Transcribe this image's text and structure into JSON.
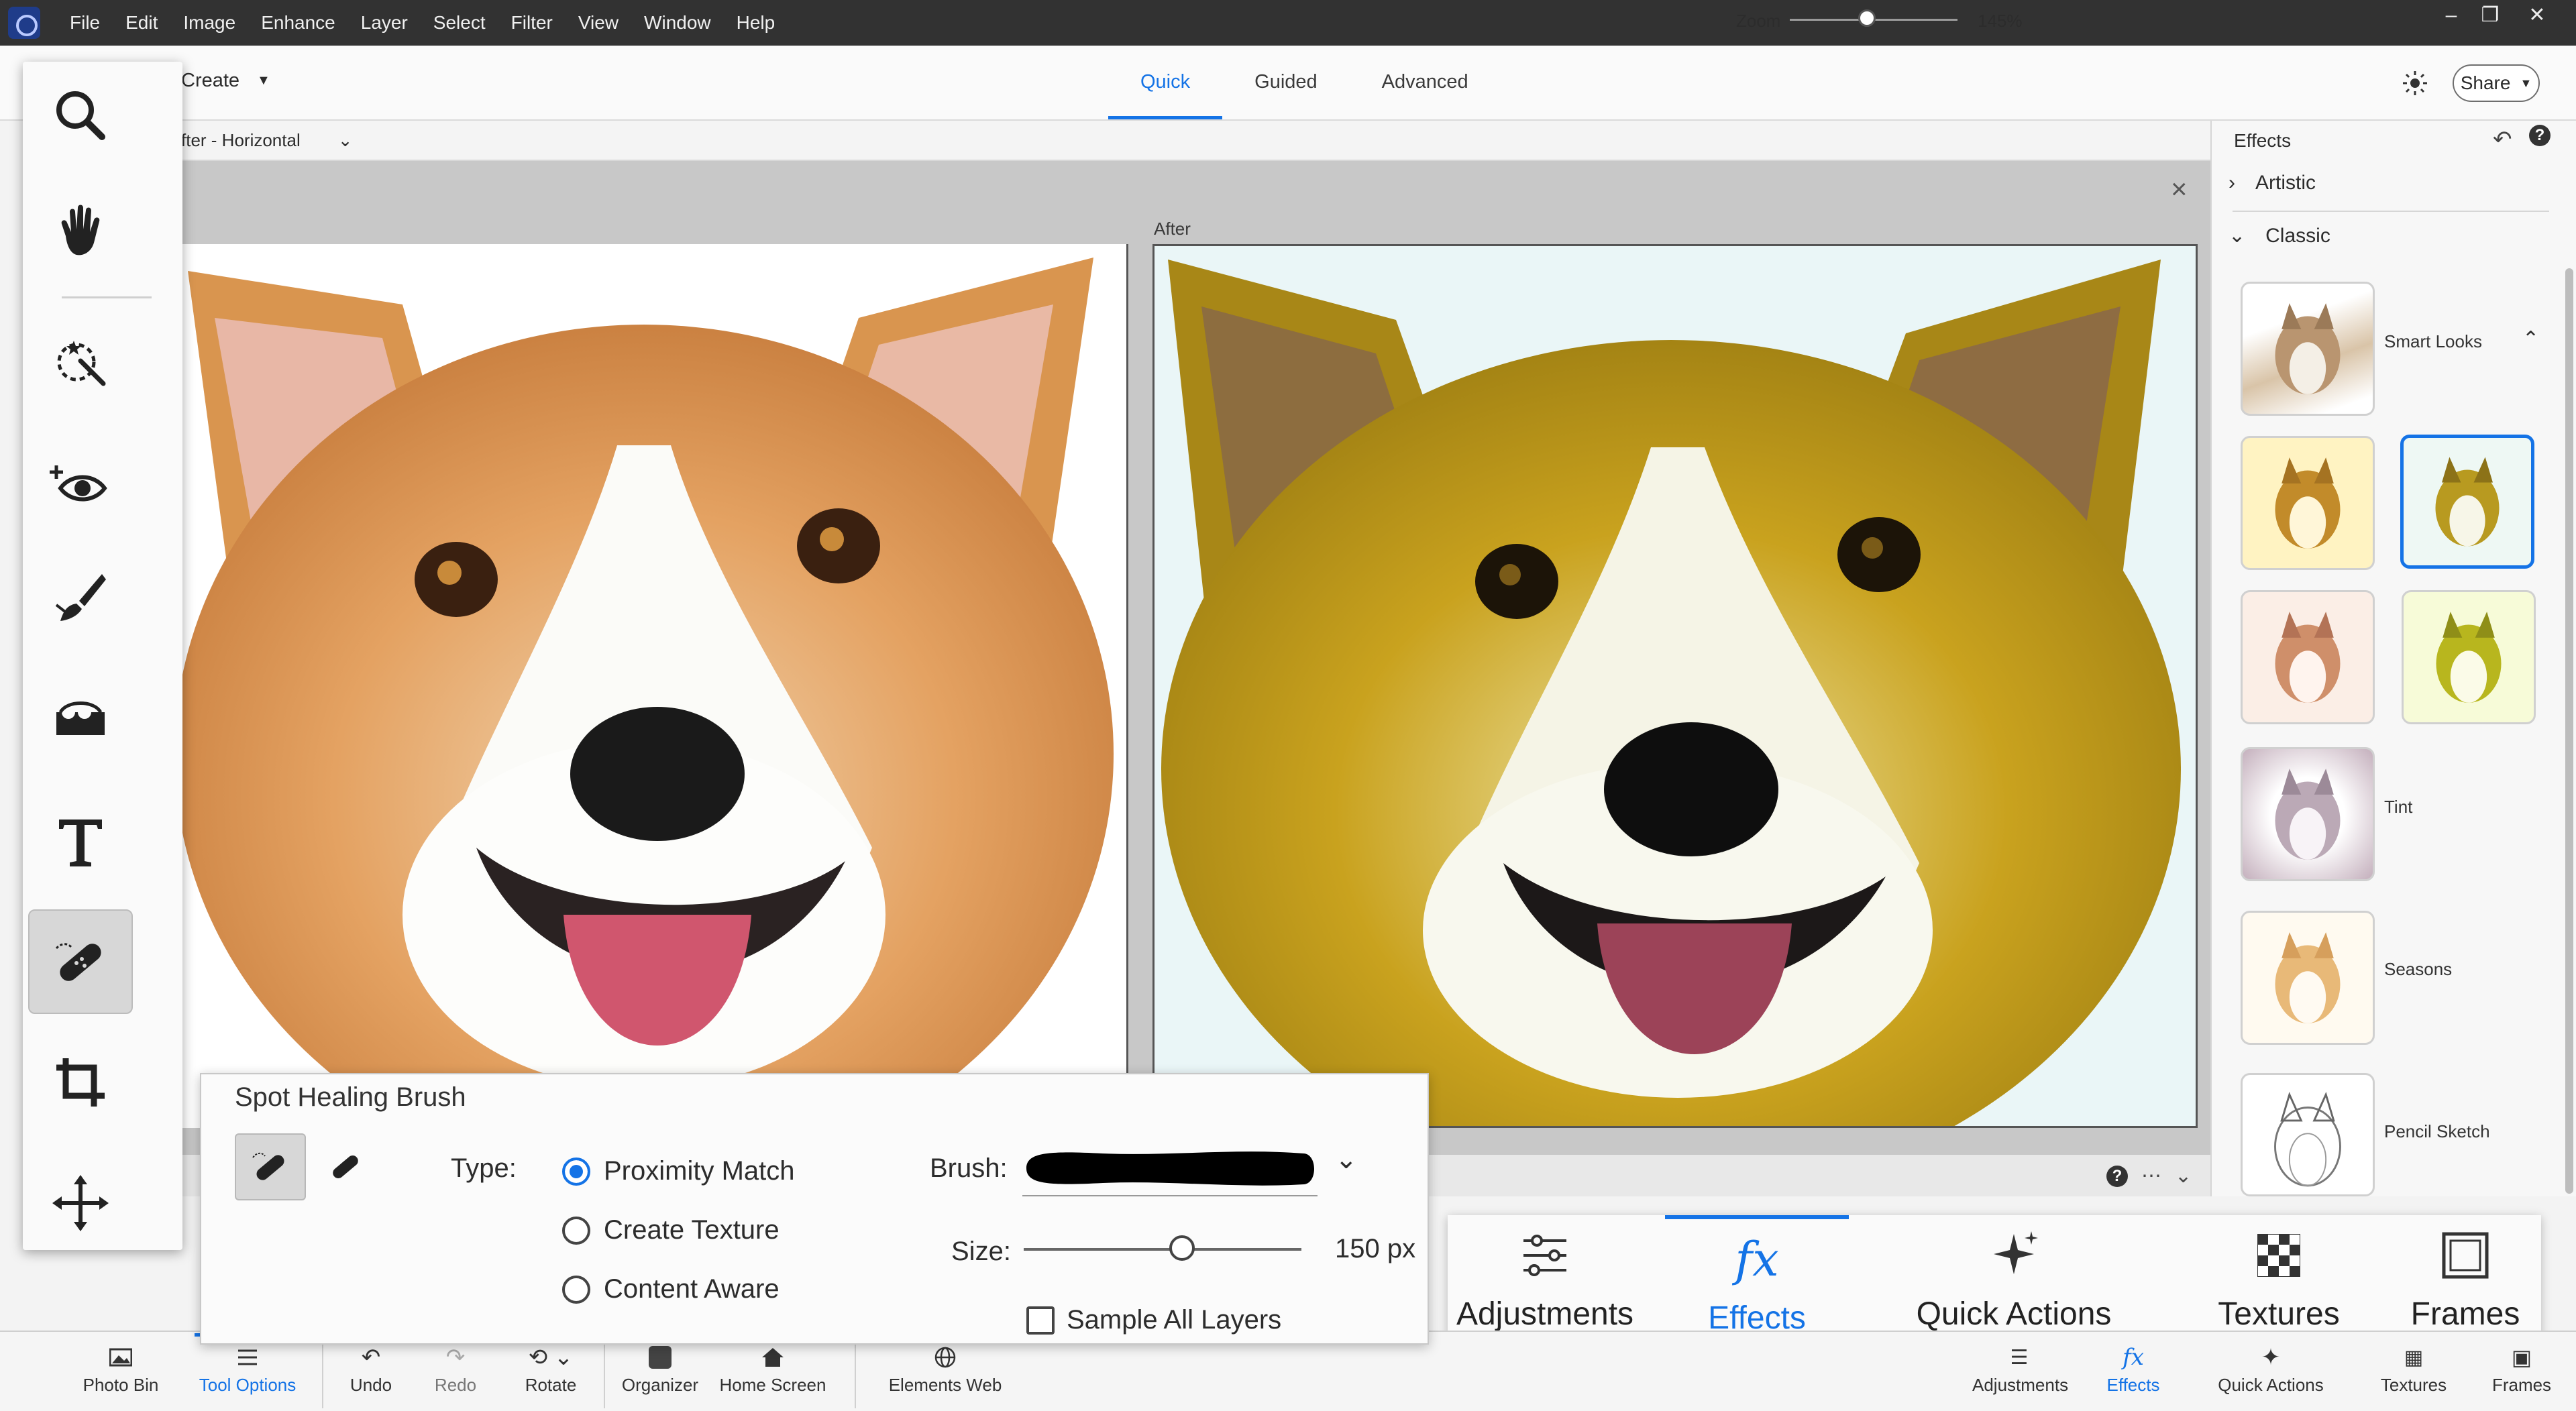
{
  "menubar": {
    "items": [
      "File",
      "Edit",
      "Image",
      "Enhance",
      "Layer",
      "Select",
      "Filter",
      "View",
      "Window",
      "Help"
    ]
  },
  "header": {
    "create_label": "Create",
    "tabs": [
      {
        "label": "Quick",
        "active": true
      },
      {
        "label": "Guided",
        "active": false
      },
      {
        "label": "Advanced",
        "active": false
      }
    ],
    "share_label": "Share"
  },
  "view_bar": {
    "view_value": "fter - Horizontal",
    "zoom_label": "Zoom",
    "zoom_value": "145%",
    "zoom_level_fraction": 0.46
  },
  "canvas": {
    "after_label": "After"
  },
  "effects_panel": {
    "title": "Effects",
    "categories": [
      {
        "label": "Artistic",
        "expanded": false
      },
      {
        "label": "Classic",
        "expanded": true
      }
    ],
    "groups": [
      {
        "label": "Smart Looks"
      },
      {
        "label": "Tint"
      },
      {
        "label": "Seasons"
      },
      {
        "label": "Pencil Sketch"
      }
    ]
  },
  "tool_options": {
    "title": "Spot Healing Brush",
    "type_label": "Type:",
    "types": [
      {
        "label": "Proximity Match",
        "selected": true
      },
      {
        "label": "Create Texture",
        "selected": false
      },
      {
        "label": "Content Aware",
        "selected": false
      }
    ],
    "brush_label": "Brush:",
    "size_label": "Size:",
    "size_value": "150 px",
    "size_fraction": 0.57,
    "sample_all_layers": "Sample All Layers",
    "sample_all_layers_checked": false
  },
  "panel_tabs": [
    {
      "label": "Adjustments",
      "icon": "sliders-icon",
      "active": false
    },
    {
      "label": "Effects",
      "icon": "fx-icon",
      "active": true
    },
    {
      "label": "Quick Actions",
      "icon": "sparkle-icon",
      "active": false
    },
    {
      "label": "Textures",
      "icon": "checker-icon",
      "active": false
    },
    {
      "label": "Frames",
      "icon": "frame-icon",
      "active": false
    }
  ],
  "taskbar": {
    "left": [
      {
        "label": "Photo Bin",
        "icon": "photo-bin-icon"
      },
      {
        "label": "Tool Options",
        "icon": "tool-options-icon",
        "active": true
      },
      {
        "label": "Undo",
        "icon": "undo-icon"
      },
      {
        "label": "Redo",
        "icon": "redo-icon",
        "disabled": true
      },
      {
        "label": "Rotate",
        "icon": "rotate-icon"
      },
      {
        "label": "Organizer",
        "icon": "organizer-icon"
      },
      {
        "label": "Home Screen",
        "icon": "home-icon"
      },
      {
        "label": "Elements Web",
        "icon": "globe-icon"
      }
    ],
    "right": [
      {
        "label": "Adjustments",
        "icon": "sliders-icon"
      },
      {
        "label": "Effects",
        "icon": "fx-icon",
        "active": true
      },
      {
        "label": "Quick Actions",
        "icon": "sparkle-icon"
      },
      {
        "label": "Textures",
        "icon": "checker-icon"
      },
      {
        "label": "Frames",
        "icon": "frame-icon"
      }
    ]
  },
  "colors": {
    "accent": "#1473e6",
    "menubar_bg": "#323232"
  }
}
